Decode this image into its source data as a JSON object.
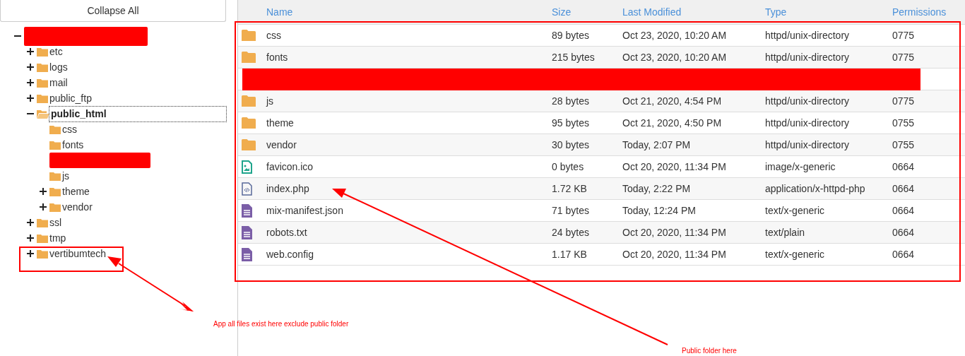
{
  "collapse_button": "Collapse All",
  "tree": [
    {
      "kind": "redacted",
      "expanded": true,
      "children": [
        {
          "kind": "branch",
          "label": "etc",
          "expanded": false,
          "selected": false
        },
        {
          "kind": "branch",
          "label": "logs",
          "expanded": false,
          "selected": false
        },
        {
          "kind": "branch",
          "label": "mail",
          "expanded": false,
          "selected": false
        },
        {
          "kind": "branch",
          "label": "public_ftp",
          "expanded": false,
          "selected": false
        },
        {
          "kind": "branch",
          "label": "public_html",
          "expanded": true,
          "selected": true,
          "children": [
            {
              "kind": "leaf",
              "label": "css",
              "selected": false
            },
            {
              "kind": "leaf",
              "label": "fonts",
              "selected": false
            },
            {
              "kind": "redacted"
            },
            {
              "kind": "leaf",
              "label": "js",
              "selected": false
            },
            {
              "kind": "branch",
              "label": "theme",
              "expanded": false,
              "selected": false
            },
            {
              "kind": "branch",
              "label": "vendor",
              "expanded": false,
              "selected": false
            }
          ]
        },
        {
          "kind": "branch",
          "label": "ssl",
          "expanded": false,
          "selected": false
        },
        {
          "kind": "branch",
          "label": "tmp",
          "expanded": false,
          "selected": false
        },
        {
          "kind": "branch",
          "label": "vertibumtech",
          "expanded": false,
          "selected": false
        }
      ]
    }
  ],
  "table": {
    "columns": [
      "Name",
      "Size",
      "Last Modified",
      "Type",
      "Permissions"
    ],
    "rows": [
      {
        "kind": "folder",
        "name": "css",
        "size": "89 bytes",
        "modified": "Oct 23, 2020, 10:20 AM",
        "type": "httpd/unix-directory",
        "permissions": "0775"
      },
      {
        "kind": "folder",
        "name": "fonts",
        "size": "215 bytes",
        "modified": "Oct 23, 2020, 10:20 AM",
        "type": "httpd/unix-directory",
        "permissions": "0775"
      },
      {
        "kind": "redacted"
      },
      {
        "kind": "folder",
        "name": "js",
        "size": "28 bytes",
        "modified": "Oct 21, 2020, 4:54 PM",
        "type": "httpd/unix-directory",
        "permissions": "0775"
      },
      {
        "kind": "folder",
        "name": "theme",
        "size": "95 bytes",
        "modified": "Oct 21, 2020, 4:50 PM",
        "type": "httpd/unix-directory",
        "permissions": "0755"
      },
      {
        "kind": "folder",
        "name": "vendor",
        "size": "30 bytes",
        "modified": "Today, 2:07 PM",
        "type": "httpd/unix-directory",
        "permissions": "0755"
      },
      {
        "kind": "image",
        "name": "favicon.ico",
        "size": "0 bytes",
        "modified": "Oct 20, 2020, 11:34 PM",
        "type": "image/x-generic",
        "permissions": "0664"
      },
      {
        "kind": "code",
        "name": "index.php",
        "size": "1.72 KB",
        "modified": "Today, 2:22 PM",
        "type": "application/x-httpd-php",
        "permissions": "0664"
      },
      {
        "kind": "text",
        "name": "mix-manifest.json",
        "size": "71 bytes",
        "modified": "Today, 12:24 PM",
        "type": "text/x-generic",
        "permissions": "0664"
      },
      {
        "kind": "text",
        "name": "robots.txt",
        "size": "24 bytes",
        "modified": "Oct 20, 2020, 11:34 PM",
        "type": "text/plain",
        "permissions": "0664"
      },
      {
        "kind": "text",
        "name": "web.config",
        "size": "1.17 KB",
        "modified": "Oct 20, 2020, 11:34 PM",
        "type": "text/x-generic",
        "permissions": "0664"
      }
    ]
  },
  "annotations": {
    "notes": [
      "App all files exist here exclude public folder",
      "Public folder here"
    ]
  }
}
